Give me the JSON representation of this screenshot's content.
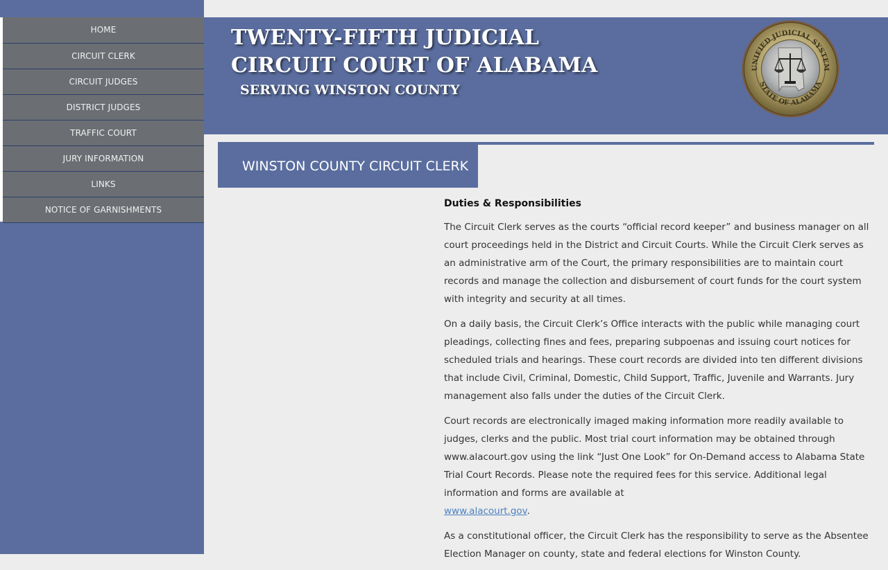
{
  "nav": {
    "items": [
      {
        "label": "HOME"
      },
      {
        "label": "CIRCUIT CLERK"
      },
      {
        "label": "CIRCUIT JUDGES"
      },
      {
        "label": "DISTRICT JUDGES"
      },
      {
        "label": "TRAFFIC COURT"
      },
      {
        "label": "JURY INFORMATION"
      },
      {
        "label": "LINKS"
      },
      {
        "label": "NOTICE OF GARNISHMENTS"
      }
    ]
  },
  "header": {
    "title_line1": "TWENTY-FIFTH JUDICIAL",
    "title_line2": "CIRCUIT COURT OF ALABAMA",
    "subtitle": "SERVING WINSTON COUNTY",
    "seal": {
      "top_text": "UNIFIED JUDICIAL SYSTEM",
      "bottom_text": "STATE OF ALABAMA"
    }
  },
  "section": {
    "title": "WINSTON COUNTY CIRCUIT CLERK"
  },
  "content": {
    "heading": "Duties & Responsibilities",
    "p1": "The Circuit Clerk serves as the courts “official record keeper” and business manager on all court proceedings held in the District and Circuit Courts. While the Circuit Clerk serves as an administrative arm of the Court, the primary responsibilities are to maintain court records and manage the collection and disbursement of court funds for the court system with integrity and security at all times.",
    "p2": "On a daily basis, the Circuit Clerk’s Office interacts with the public while managing court pleadings, collecting fines and fees, preparing subpoenas and issuing court notices for scheduled trials and hearings. These court records are divided into ten different divisions that include Civil, Criminal, Domestic, Child Support, Traffic, Juvenile and Warrants. Jury management also falls under the duties of the Circuit Clerk.",
    "p3": "Court records are electronically imaged making information more readily available to judges, clerks and the public. Most trial court information may be obtained through www.alacourt.gov using the link “Just One Look” for On-Demand access to Alabama State Trial Court Records. Please note the required fees for this service. Additional legal information and forms are available at",
    "p3_link": "www.alacourt.gov",
    "p3_end": ".",
    "p4": "As a constitutional officer, the Circuit Clerk has the responsibility to serve as the Absentee Election Manager on county, state and federal elections for Winston County."
  }
}
